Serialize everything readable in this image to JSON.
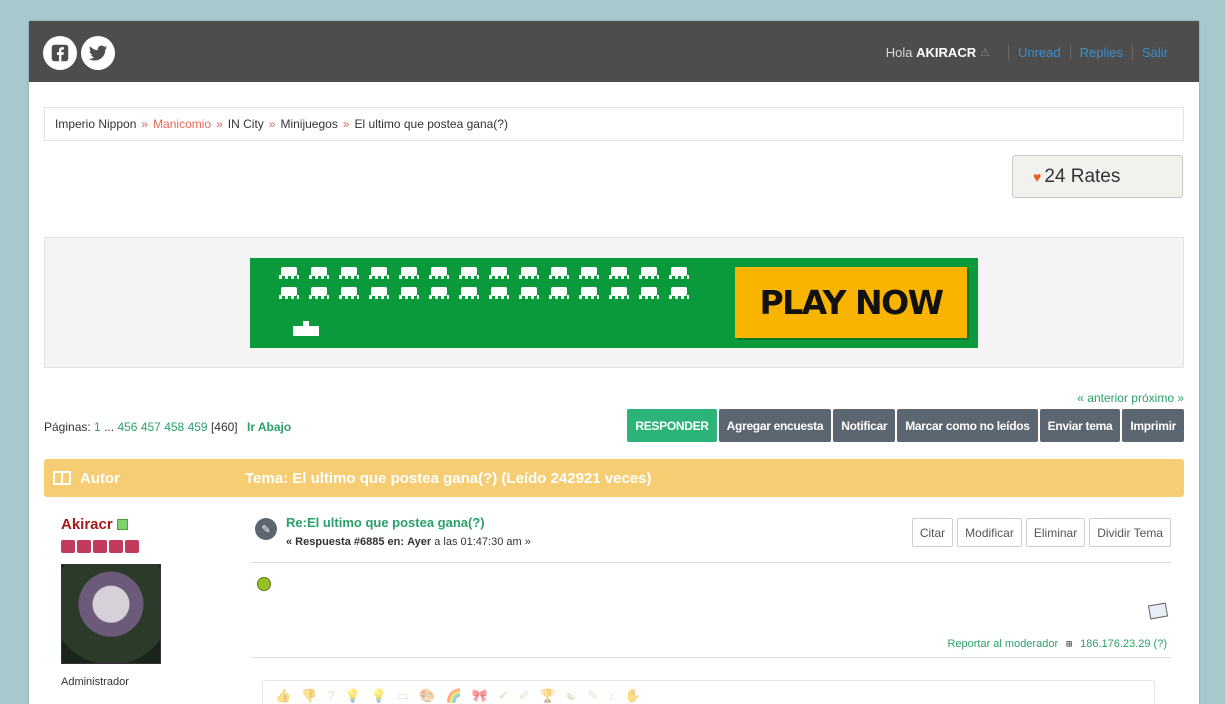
{
  "topbar": {
    "greeting": "Hola",
    "username": "AKIRACR",
    "links": [
      "Unread",
      "Replies",
      "Salir"
    ]
  },
  "breadcrumb": {
    "items": [
      "Imperio Nippon",
      "Manicomio",
      "IN City",
      "Minijuegos",
      "El ultimo que postea gana(?)"
    ],
    "separator": "»"
  },
  "rates": {
    "label": "24 Rates"
  },
  "ad": {
    "cta": "PLAY NOW"
  },
  "pagination": {
    "label": "Páginas:",
    "first": "1",
    "ellipsis": "...",
    "pages": [
      "456",
      "457",
      "458",
      "459"
    ],
    "current": "[460]",
    "go_down": "Ir Abajo",
    "prev_next": "« anterior próximo »"
  },
  "actions": [
    "RESPONDER",
    "Agregar encuesta",
    "Notificar",
    "Marcar como no leídos",
    "Enviar tema",
    "Imprimir"
  ],
  "thread_header": {
    "author_label": "Autor",
    "topic": "Tema: El ultimo que postea gana(?)  (Leído 242921 veces)"
  },
  "poster": {
    "name": "Akiracr",
    "role": "Administrador"
  },
  "post": {
    "title": "Re:El ultimo que postea gana(?)",
    "meta_prefix": "« Respuesta #6885 en:",
    "meta_day": "Ayer",
    "meta_time": "a las 01:47:30 am »",
    "buttons": [
      "Citar",
      "Modificar",
      "Eliminar",
      "Dividir Tema"
    ],
    "report": "Reportar al moderador",
    "ip": "186.176.23.29 (?)"
  },
  "colors": {
    "accent_green": "#2aa06b",
    "header_yellow": "#f7cd73",
    "topbar_dark": "#4d4d4d",
    "button_slate": "#5c6671"
  }
}
